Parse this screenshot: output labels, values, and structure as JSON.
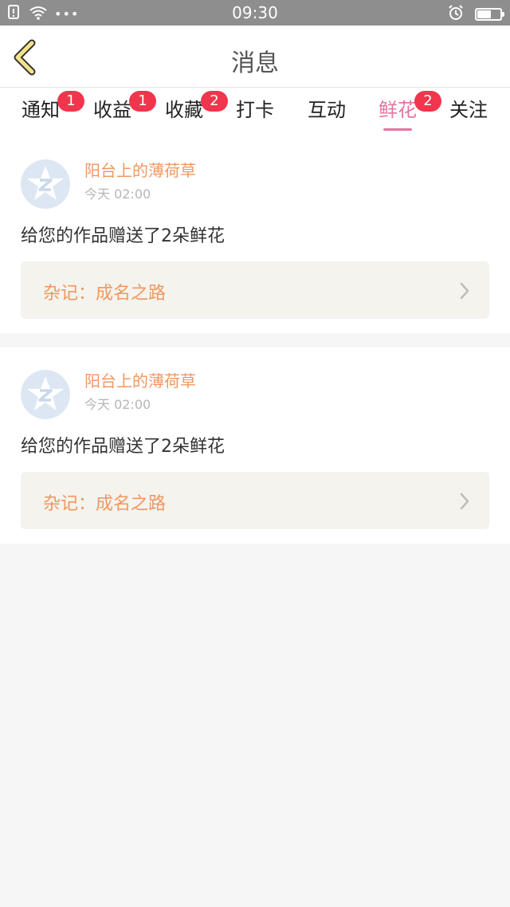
{
  "status_bar": {
    "time": "09:30",
    "dots": "•••",
    "icons": [
      "sim-alert-icon",
      "wifi-icon",
      "alarm-icon",
      "battery-icon"
    ],
    "battery_level": 0.6
  },
  "header": {
    "title": "消息",
    "back_icon": "chevron-left-icon",
    "back_color": "#f4e28a"
  },
  "tabs": [
    {
      "label": "通知",
      "badge": "1"
    },
    {
      "label": "收益",
      "badge": "1"
    },
    {
      "label": "收藏",
      "badge": "2"
    },
    {
      "label": "打卡",
      "badge": ""
    },
    {
      "label": "互动",
      "badge": ""
    },
    {
      "label": "鲜花",
      "badge": "2",
      "active": true
    },
    {
      "label": "关注",
      "badge": ""
    }
  ],
  "messages": [
    {
      "sender": "阳台上的薄荷草",
      "time": "今天 02:00",
      "text": "给您的作品赠送了2朵鲜花",
      "work_title": "杂记：成名之路"
    },
    {
      "sender": "阳台上的薄荷草",
      "time": "今天 02:00",
      "text": "给您的作品赠送了2朵鲜花",
      "work_title": "杂记：成名之路"
    }
  ],
  "colors": {
    "accent": "#e5749f",
    "badge": "#f0354d",
    "name": "#f09860",
    "status_bar": "#8e8e8e"
  }
}
